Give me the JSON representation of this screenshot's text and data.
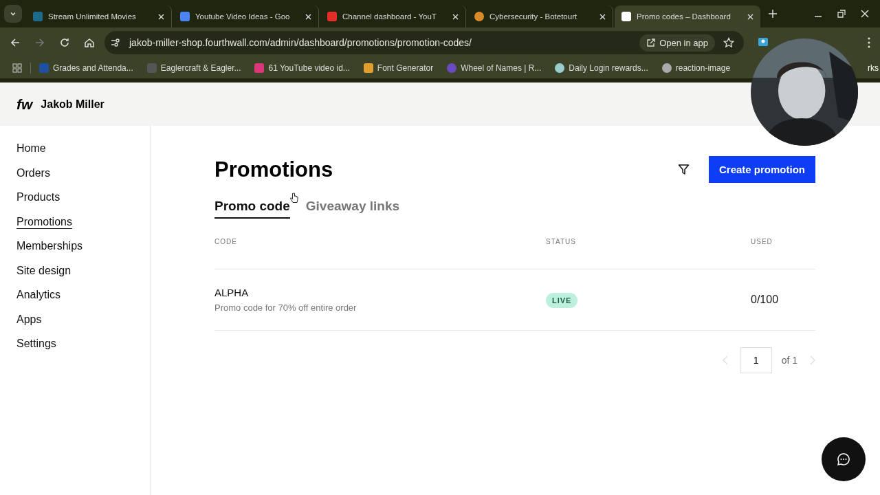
{
  "browser": {
    "tabs": [
      {
        "title": "Stream Unlimited Movies",
        "selected": false
      },
      {
        "title": "Youtube Video Ideas - Goo",
        "selected": false
      },
      {
        "title": "Channel dashboard - YouT",
        "selected": false
      },
      {
        "title": "Cybersecurity - Botetourt",
        "selected": false
      },
      {
        "title": "Promo codes – Dashboard",
        "selected": true
      }
    ],
    "url": "jakob-miller-shop.fourthwall.com/admin/dashboard/promotions/promotion-codes/",
    "open_in_app": "Open in app",
    "bookmarks": [
      "Grades and Attenda...",
      "Eaglercraft & Eagler...",
      "61 YouTube video id...",
      "Font Generator",
      "Wheel of Names | R...",
      "Daily Login rewards...",
      "reaction-image"
    ],
    "bookmarks_cut": "rks"
  },
  "header": {
    "logo": "fw",
    "shop_name": "Jakob Miller"
  },
  "sidebar": {
    "items": [
      {
        "label": "Home",
        "selected": false
      },
      {
        "label": "Orders",
        "selected": false
      },
      {
        "label": "Products",
        "selected": false
      },
      {
        "label": "Promotions",
        "selected": true
      },
      {
        "label": "Memberships",
        "selected": false
      },
      {
        "label": "Site design",
        "selected": false
      },
      {
        "label": "Analytics",
        "selected": false
      },
      {
        "label": "Apps",
        "selected": false
      },
      {
        "label": "Settings",
        "selected": false
      }
    ]
  },
  "page": {
    "title": "Promotions",
    "create_button": "Create promotion",
    "tabs": [
      {
        "label": "Promo code",
        "selected": true
      },
      {
        "label": "Giveaway links",
        "selected": false
      }
    ],
    "table": {
      "columns": [
        "CODE",
        "STATUS",
        "USED"
      ],
      "rows": [
        {
          "code": "ALPHA",
          "description": "Promo code for 70% off entire order",
          "status": "LIVE",
          "used": "0/100"
        }
      ]
    },
    "pagination": {
      "page": "1",
      "of": "of 1"
    }
  }
}
